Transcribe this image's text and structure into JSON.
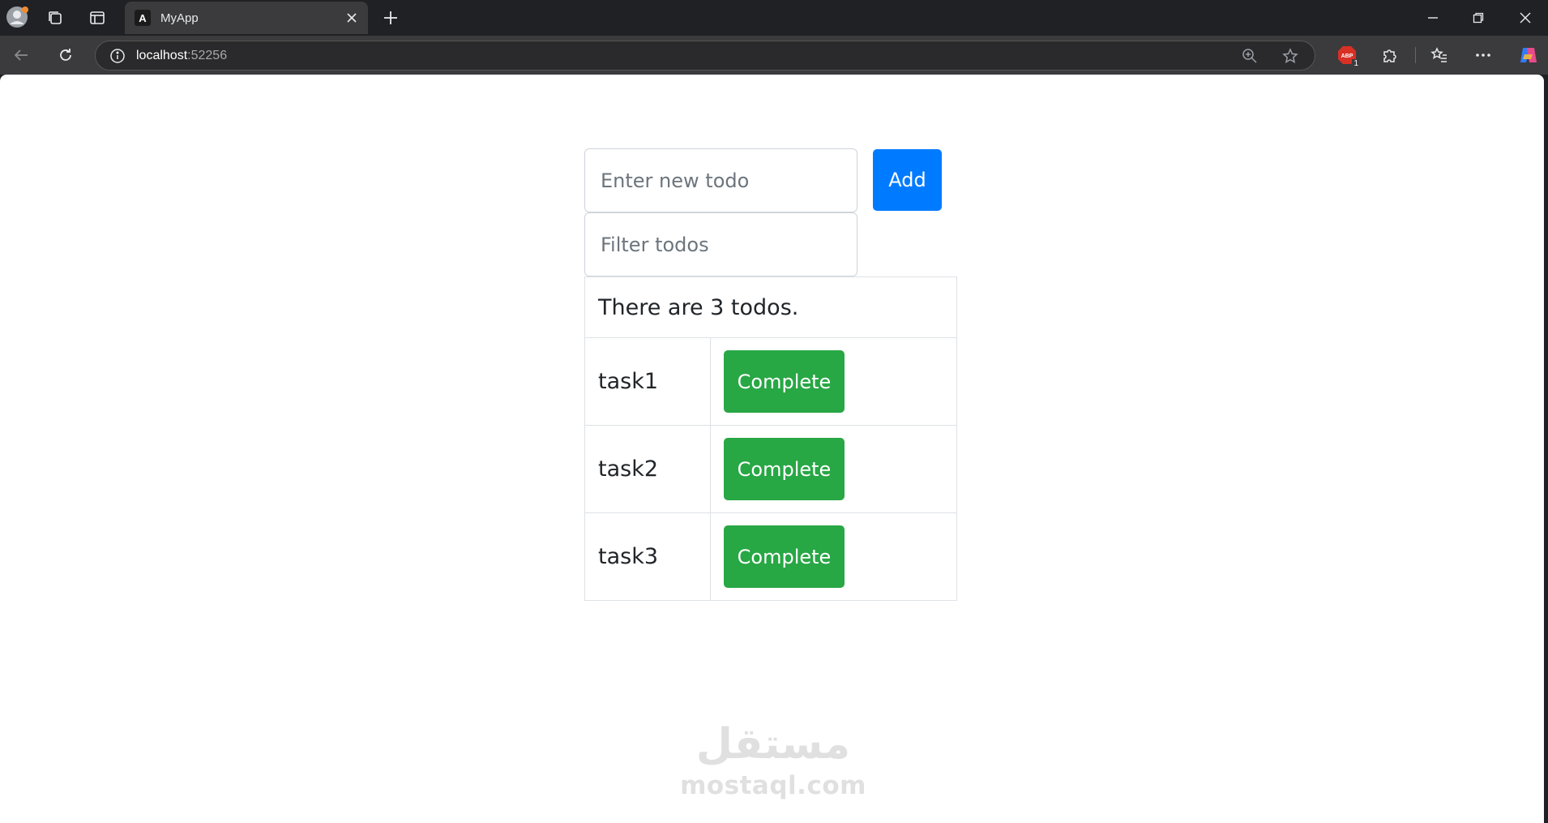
{
  "browser": {
    "tab_title": "MyApp",
    "tab_favicon_letter": "A",
    "url_host": "localhost",
    "url_port": ":52256",
    "extension_badge": "1"
  },
  "app": {
    "new_todo_placeholder": "Enter new todo",
    "filter_placeholder": "Filter todos",
    "add_label": "Add",
    "count_text": "There are 3 todos.",
    "todos": [
      {
        "name": "task1",
        "action": "Complete"
      },
      {
        "name": "task2",
        "action": "Complete"
      },
      {
        "name": "task3",
        "action": "Complete"
      }
    ]
  },
  "watermark": {
    "arabic_logo": "مستقل",
    "site": "mostaql.com"
  },
  "colors": {
    "primary": "#007bff",
    "success": "#28a745",
    "border": "#dee2e6"
  }
}
